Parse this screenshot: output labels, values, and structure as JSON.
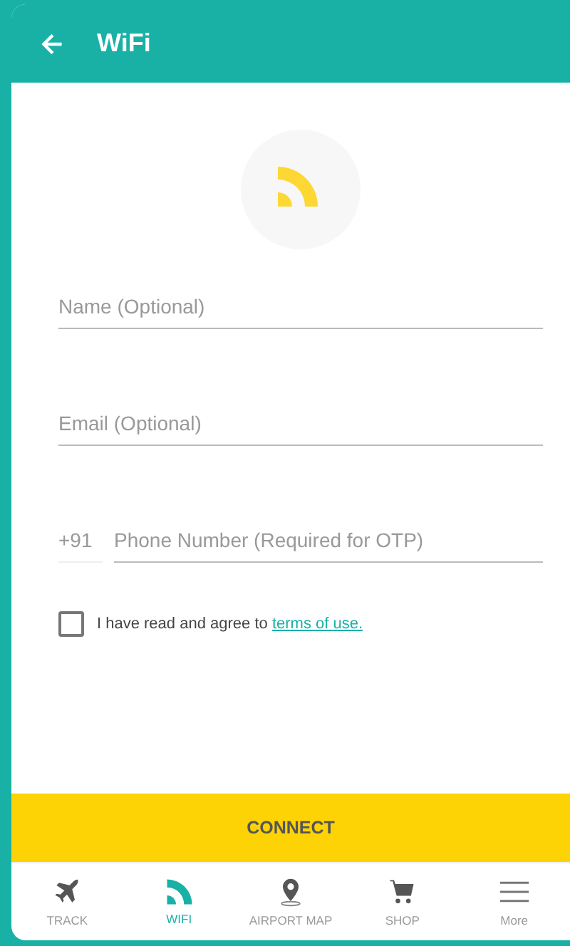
{
  "header": {
    "title": "WiFi"
  },
  "fields": [
    {
      "placeholder": "Name (Optional)"
    },
    {
      "placeholder": "Email (Optional)"
    }
  ],
  "phone": {
    "prefix": "+91",
    "placeholder": "Phone Number (Required for OTP)"
  },
  "agreement": {
    "checked": false,
    "text": "I have read and agree to ",
    "link": "terms of use."
  },
  "connect_button": "CONNECT",
  "nav": [
    {
      "kind": "plane",
      "label": "TRACK",
      "selected": false
    },
    {
      "kind": "wifi",
      "label": "WIFI",
      "selected": true
    },
    {
      "kind": "pin",
      "label": "AIRPORT MAP",
      "selected": false
    },
    {
      "kind": "cart",
      "label": "SHOP",
      "selected": false
    },
    {
      "kind": "menu",
      "label": "More",
      "selected": false
    }
  ]
}
